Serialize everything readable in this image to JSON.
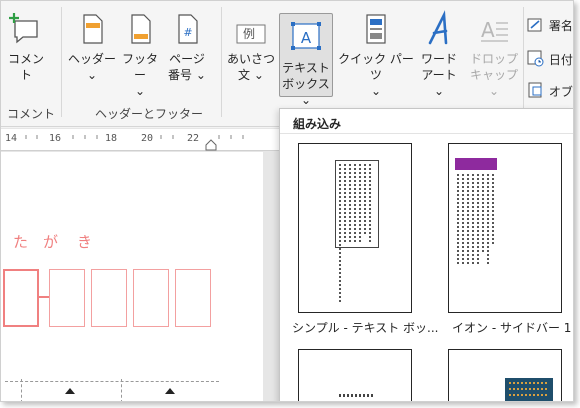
{
  "ribbon": {
    "comment": {
      "label": "コメント",
      "group": "コメント"
    },
    "header": {
      "label": "ヘッダー",
      "arrow": "⌄"
    },
    "footer": {
      "label": "フッター",
      "arrow": "⌄"
    },
    "page_number": {
      "label1": "ページ",
      "label2": "番号",
      "arrow": "⌄"
    },
    "header_footer_group": "ヘッダーとフッター",
    "greeting": {
      "icon_text": "例",
      "label1": "あいさつ",
      "label2": "文",
      "arrow": "⌄"
    },
    "textbox": {
      "label1": "テキスト",
      "label2": "ボックス",
      "arrow": "⌄"
    },
    "quick_parts": {
      "label": "クイック パーツ",
      "arrow": "⌄"
    },
    "wordart": {
      "label1": "ワード",
      "label2": "アート",
      "arrow": "⌄"
    },
    "dropcap": {
      "label1": "ドロップ",
      "label2": "キャップ",
      "arrow": "⌄"
    },
    "signature": {
      "label": "署名"
    },
    "date": {
      "label": "日付"
    },
    "object": {
      "label": "オブ"
    }
  },
  "ruler": {
    "ticks": [
      "14",
      "16",
      "18",
      "20",
      "22"
    ]
  },
  "document": {
    "kana": [
      "た",
      "が",
      "き"
    ]
  },
  "gallery": {
    "title": "組み込み",
    "items": [
      {
        "label": "シンプル - テキスト ボッ..."
      },
      {
        "label": "イオン - サイドバー 1"
      }
    ]
  },
  "colors": {
    "accent_selected": "#e0e0e0",
    "kana": "#f08080",
    "ion_purple": "#8e2a9e",
    "dark_teal": "#1f4e6b"
  }
}
